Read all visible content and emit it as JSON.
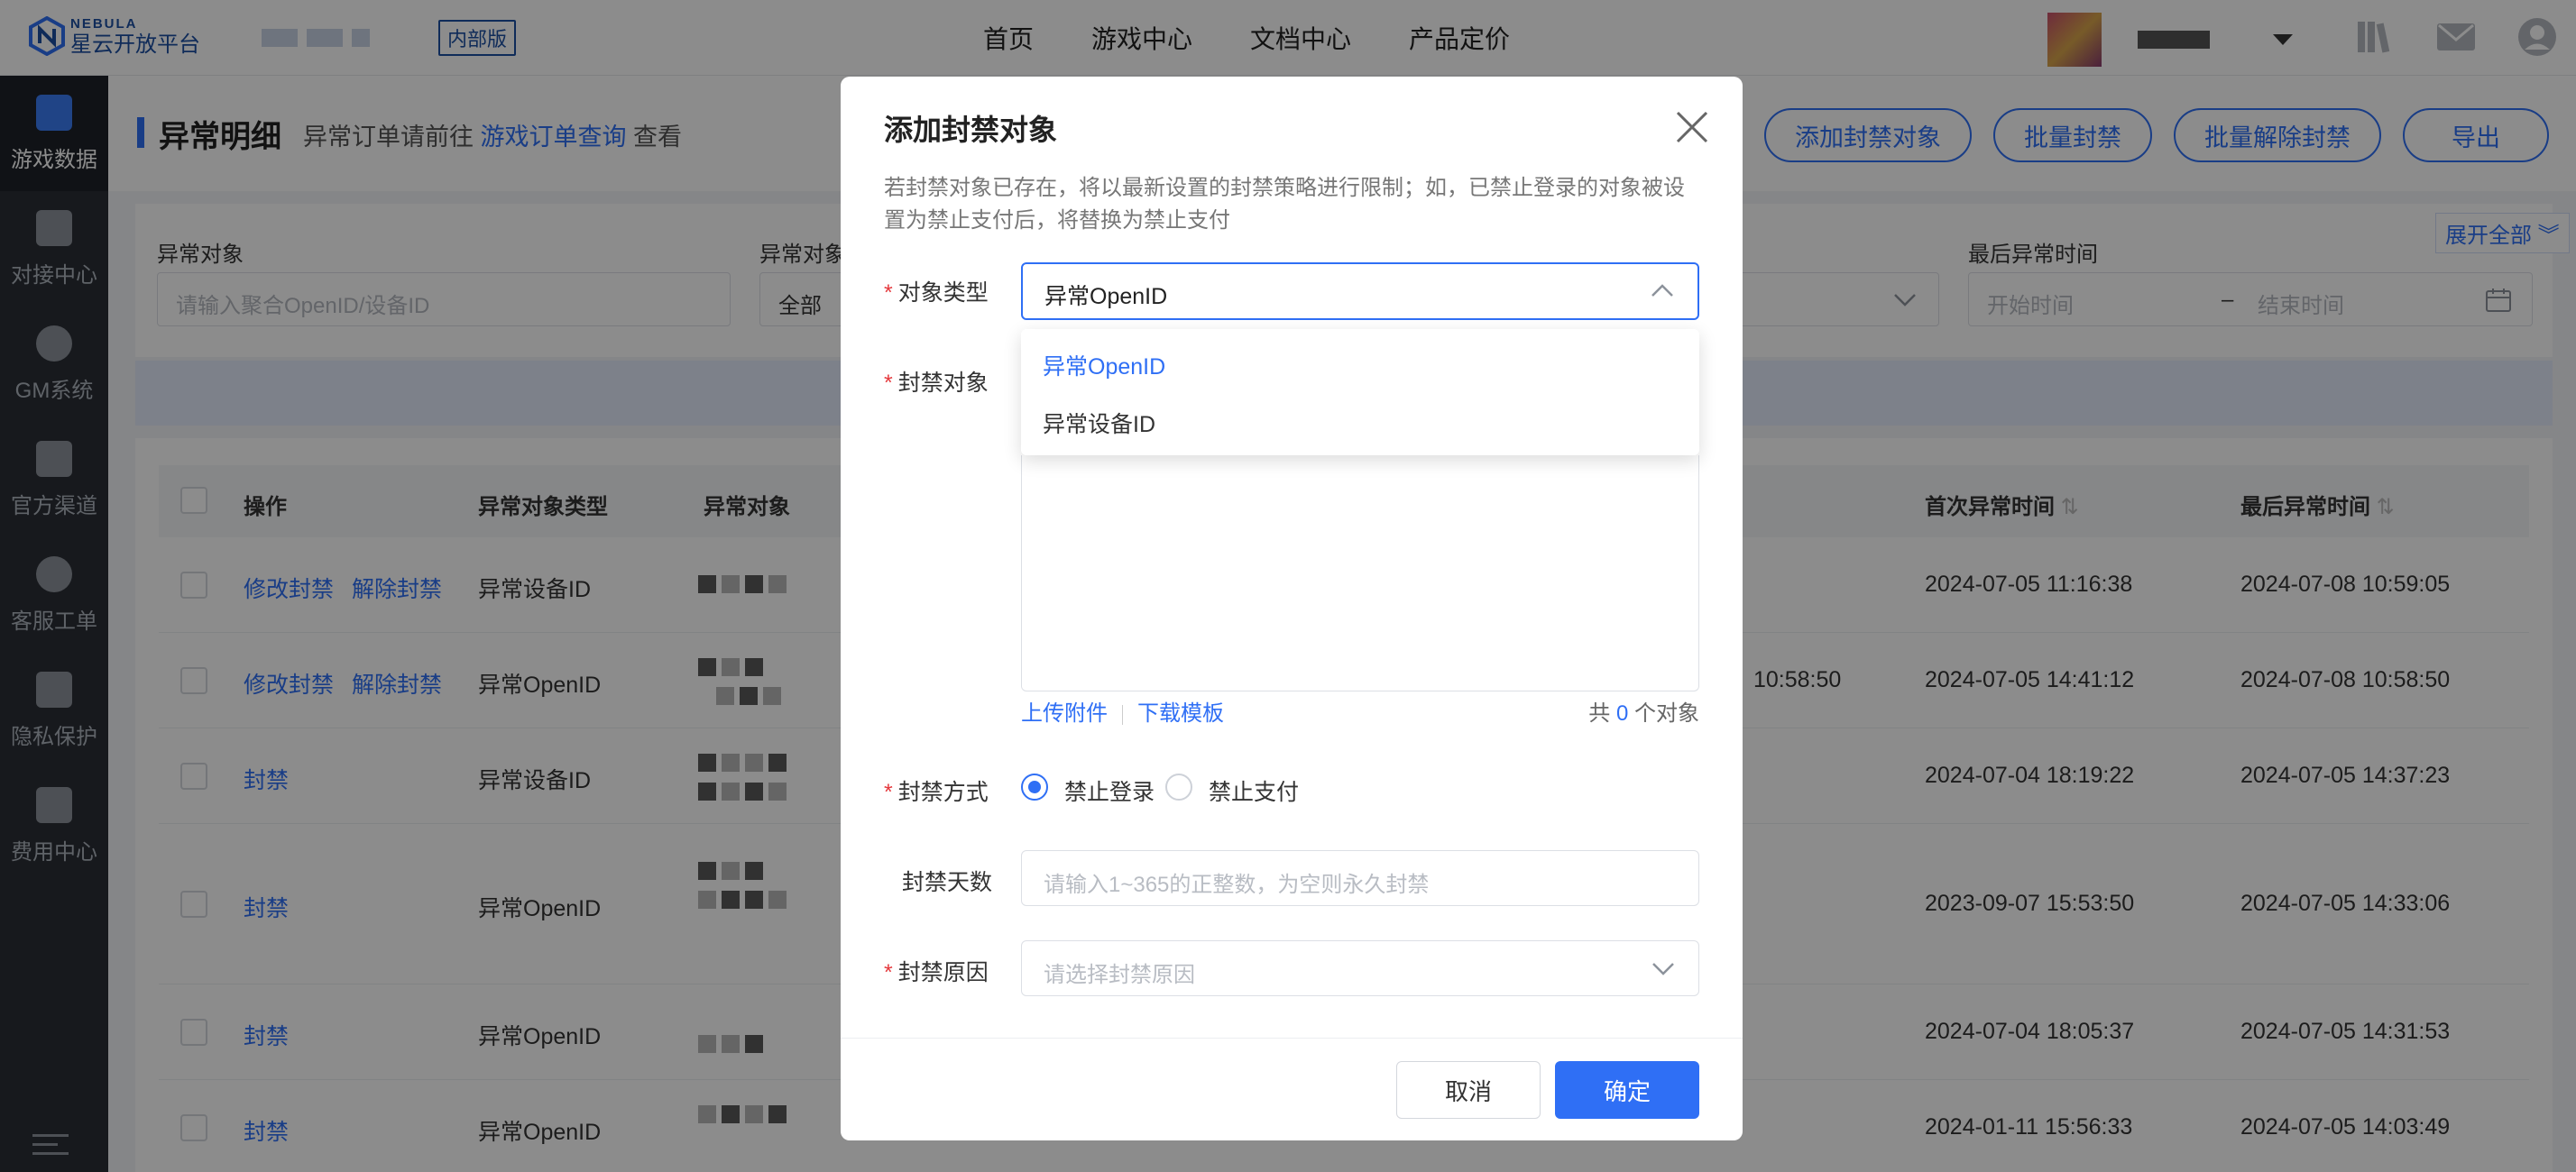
{
  "header": {
    "logo_en": "NEBULA",
    "logo_cn": "星云开放平台",
    "badge": "内部版",
    "nav": [
      "首页",
      "游戏中心",
      "文档中心",
      "产品定价"
    ]
  },
  "sidebar": {
    "items": [
      {
        "label": "游戏数据",
        "icon": "bar-chart-icon"
      },
      {
        "label": "对接中心",
        "icon": "plugin-icon"
      },
      {
        "label": "GM系统",
        "icon": "gm-icon"
      },
      {
        "label": "官方渠道",
        "icon": "card-icon"
      },
      {
        "label": "客服工单",
        "icon": "headset-icon"
      },
      {
        "label": "隐私保护",
        "icon": "lock-icon"
      },
      {
        "label": "费用中心",
        "icon": "bill-icon"
      }
    ]
  },
  "page": {
    "title": "异常明细",
    "sub_prefix": "异常订单请前往",
    "sub_link": "游戏订单查询",
    "sub_suffix": "查看",
    "buttons": [
      "添加封禁对象",
      "批量封禁",
      "批量解除封禁",
      "导出"
    ]
  },
  "filters": {
    "expand_all": "展开全部",
    "object_label": "异常对象",
    "object_placeholder": "请输入聚合OpenID/设备ID",
    "type_label": "异常对象",
    "type_value": "全部",
    "last_time_label": "最后异常时间",
    "start_placeholder": "开始时间",
    "range_sep": "–",
    "end_placeholder": "结束时间"
  },
  "table": {
    "headers": [
      "操作",
      "异常对象类型",
      "异常对象",
      "首次异常时间",
      "最后异常时间"
    ],
    "rows": [
      {
        "actions": [
          "修改封禁",
          "解除封禁"
        ],
        "type": "异常设备ID",
        "mid": "",
        "first": "2024-07-05 11:16:38",
        "last": "2024-07-08 10:59:05"
      },
      {
        "actions": [
          "修改封禁",
          "解除封禁"
        ],
        "type": "异常OpenID",
        "mid": "10:58:50",
        "first": "2024-07-05 14:41:12",
        "last": "2024-07-08 10:58:50"
      },
      {
        "actions": [
          "封禁"
        ],
        "type": "异常设备ID",
        "mid": "",
        "first": "2024-07-04 18:19:22",
        "last": "2024-07-05 14:37:23"
      },
      {
        "actions": [
          "封禁"
        ],
        "type": "异常OpenID",
        "mid": "",
        "first": "2023-09-07 15:53:50",
        "last": "2024-07-05 14:33:06"
      },
      {
        "actions": [
          "封禁"
        ],
        "type": "异常OpenID",
        "mid": "",
        "first": "2024-07-04 18:05:37",
        "last": "2024-07-05 14:31:53"
      },
      {
        "actions": [
          "封禁"
        ],
        "type": "异常OpenID",
        "mid": "",
        "first": "2024-01-11 15:56:33",
        "last": "2024-07-05 14:03:49"
      }
    ]
  },
  "modal": {
    "title": "添加封禁对象",
    "note": "若封禁对象已存在，将以最新设置的封禁策略进行限制；如，已禁止登录的对象被设置为禁止支付后，将替换为禁止支付",
    "type_label": "对象类型",
    "type_value": "异常OpenID",
    "options": [
      "异常OpenID",
      "异常设备ID"
    ],
    "target_label": "封禁对象",
    "upload": "上传附件",
    "template": "下载模板",
    "count_prefix": "共",
    "count": "0",
    "count_suffix": "个对象",
    "method_label": "封禁方式",
    "method_options": [
      "禁止登录",
      "禁止支付"
    ],
    "selected_method": "禁止登录",
    "days_label": "封禁天数",
    "days_placeholder": "请输入1~365的正整数，为空则永久封禁",
    "reason_label": "封禁原因",
    "reason_placeholder": "请选择封禁原因",
    "cancel": "取消",
    "ok": "确定"
  }
}
